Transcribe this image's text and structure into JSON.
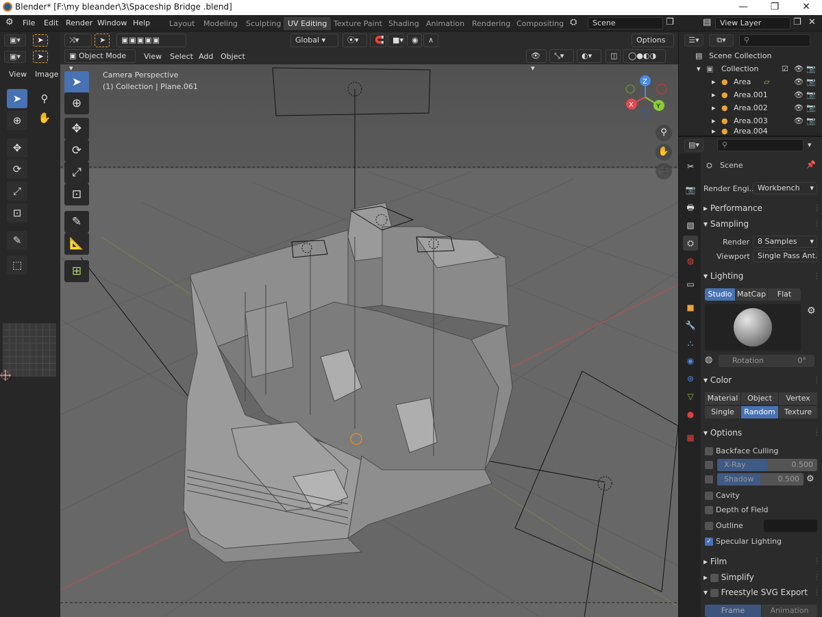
{
  "window": {
    "title": "Blender* [F:\\my bleander\\3\\Spaceship Bridge .blend]",
    "min": "—",
    "max": "❐",
    "close": "✕"
  },
  "menu": [
    "File",
    "Edit",
    "Render",
    "Window",
    "Help"
  ],
  "workspace_tabs": [
    "Layout",
    "Modeling",
    "Sculpting",
    "UV Editing",
    "Texture Paint",
    "Shading",
    "Animation",
    "Rendering",
    "Compositing"
  ],
  "active_workspace": "UV Editing",
  "scene_name": "Scene",
  "view_layer": "View Layer",
  "uv_editor": {
    "menus": [
      "View",
      "Image"
    ]
  },
  "viewport": {
    "mode": "Object Mode",
    "menus": [
      "View",
      "Select",
      "Add",
      "Object"
    ],
    "transform_orientation": "Global",
    "options": "Options",
    "camera_label": "Camera Perspective",
    "object_label": "(1) Collection | Plane.061",
    "gizmo": {
      "x": "X",
      "y": "Y",
      "z": "Z"
    }
  },
  "outliner": {
    "root": "Scene Collection",
    "collection": "Collection",
    "items": [
      "Area",
      "Area.001",
      "Area.002",
      "Area.003",
      "Area.004"
    ]
  },
  "properties": {
    "context": "Scene",
    "render_engine_label": "Render Engi...",
    "render_engine": "Workbench",
    "panels": {
      "performance": "Performance",
      "sampling": "Sampling",
      "lighting": "Lighting",
      "color": "Color",
      "options": "Options",
      "film": "Film",
      "simplify": "Simplify",
      "freestyle": "Freestyle SVG Export"
    },
    "sampling": {
      "render_label": "Render",
      "render_value": "8 Samples",
      "viewport_label": "Viewport",
      "viewport_value": "Single Pass Ant..."
    },
    "lighting_modes": [
      "Studio",
      "MatCap",
      "Flat"
    ],
    "lighting_active": "Studio",
    "rotation_label": "Rotation",
    "rotation_value": "0°",
    "color_row1": [
      "Material",
      "Object",
      "Vertex"
    ],
    "color_row2": [
      "Single",
      "Random",
      "Texture"
    ],
    "color_active": "Random",
    "options": {
      "backface": "Backface Culling",
      "xray": "X-Ray",
      "xray_value": "0.500",
      "shadow": "Shadow",
      "shadow_value": "0.500",
      "cavity": "Cavity",
      "dof": "Depth of Field",
      "outline": "Outline",
      "specular": "Specular Lighting"
    },
    "freestyle_tabs": [
      "Frame",
      "Animation"
    ]
  },
  "colors": {
    "accent": "#4772b3",
    "viewport_bg": "#646464",
    "panel_bg": "#2b2b2b",
    "axis_x": "#e8474f",
    "axis_y": "#8bcc3c",
    "axis_z": "#4a8ae8"
  }
}
